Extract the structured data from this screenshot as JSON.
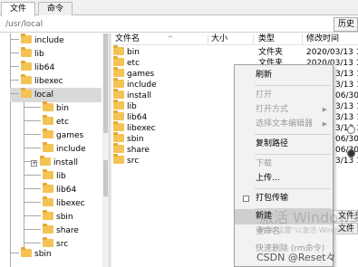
{
  "tabs": [
    "文件",
    "命令"
  ],
  "path": {
    "value": "/usr/local",
    "history_label": "历史"
  },
  "tree": [
    {
      "label": "include",
      "expander": ""
    },
    {
      "label": "lib",
      "expander": ""
    },
    {
      "label": "lib64",
      "expander": ""
    },
    {
      "label": "libexec",
      "expander": ""
    },
    {
      "label": "local",
      "expander": "−",
      "selected": true
    },
    {
      "label": "bin",
      "expander": ""
    },
    {
      "label": "etc",
      "expander": ""
    },
    {
      "label": "games",
      "expander": ""
    },
    {
      "label": "include",
      "expander": ""
    },
    {
      "label": "install",
      "expander": "+"
    },
    {
      "label": "lib",
      "expander": ""
    },
    {
      "label": "lib64",
      "expander": ""
    },
    {
      "label": "libexec",
      "expander": ""
    },
    {
      "label": "sbin",
      "expander": ""
    },
    {
      "label": "share",
      "expander": ""
    },
    {
      "label": "src",
      "expander": ""
    },
    {
      "label": "sbin",
      "expander": ""
    }
  ],
  "columns": {
    "name": "文件名",
    "sort_arrow": "^",
    "size": "大小",
    "type": "类型",
    "mtime": "修改时间"
  },
  "files": [
    {
      "name": "bin",
      "type": "文件夹",
      "mtime": "2020/03/13 1"
    },
    {
      "name": "etc",
      "type": "文件夹",
      "mtime": "2020/03/13 1"
    },
    {
      "name": "games",
      "type": "",
      "mtime": "3/13 1"
    },
    {
      "name": "include",
      "type": "",
      "mtime": "3/13 1"
    },
    {
      "name": "install",
      "type": "",
      "mtime": "06/30 1"
    },
    {
      "name": "lib",
      "type": "",
      "mtime": "3/13 1"
    },
    {
      "name": "lib64",
      "type": "",
      "mtime": "3/13 1"
    },
    {
      "name": "libexec",
      "type": "",
      "mtime": "3/13 1"
    },
    {
      "name": "sbin",
      "type": "",
      "mtime": "06/30 1"
    },
    {
      "name": "share",
      "type": "",
      "mtime": "06/30 1"
    },
    {
      "name": "src",
      "type": "",
      "mtime": "3/13 1"
    }
  ],
  "context_menu": {
    "refresh": "刷新",
    "open": "打开",
    "open_with": "打开方式",
    "choose_editor": "选择文本编辑器",
    "copy_path": "复制路径",
    "download": "下载",
    "upload": "上传...",
    "pack_transfer": "打包传输",
    "new": "新建",
    "rename": "重命名",
    "quick_delete": "快速删除 (rm命令)"
  },
  "submenu": {
    "file_folder": "文件夹",
    "file": "文件"
  },
  "watermark": {
    "line1": "激活 Windows",
    "line2": "转到\"设置\"以激活 Windows。",
    "csdn": "CSDN @Reset々"
  },
  "colors": {
    "folder": "#f3c355",
    "menu_bg": "#f2f2f2",
    "highlight": "#cfcfcf",
    "disabled": "#9b9b9b"
  }
}
